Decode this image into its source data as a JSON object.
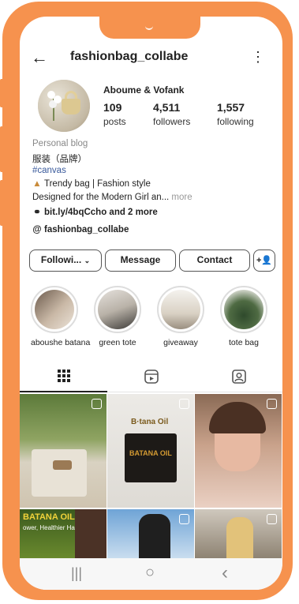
{
  "profile": {
    "handle": "fashionbag_collabe",
    "display_name": "Aboume & Vofank",
    "stats": [
      {
        "value": "109",
        "label": "posts"
      },
      {
        "value": "4,511",
        "label": "followers"
      },
      {
        "value": "1,557",
        "label": "following"
      }
    ],
    "category": "Personal blog",
    "bio_line_2": "服装（品牌）",
    "hashtag": "#canvas",
    "bio_line_4": "Trendy bag | Fashion style",
    "bio_line_5": "Designed for the Modern Girl an...",
    "more_label": " more",
    "link_text": "bit.ly/4bqCcho and 2 more",
    "threads_handle": "fashionbag_collabe"
  },
  "buttons": {
    "following": "Followi...",
    "message": "Message",
    "contact": "Contact"
  },
  "highlights": [
    {
      "label": "aboushe batana"
    },
    {
      "label": "green tote"
    },
    {
      "label": "giveaway"
    },
    {
      "label": "tote bag"
    }
  ],
  "posts": [
    {
      "caption": ""
    },
    {
      "caption": "Batana Oil"
    },
    {
      "caption": ""
    },
    {
      "caption": "BATANA OIL"
    },
    {
      "caption": ""
    },
    {
      "caption": ""
    }
  ],
  "posts_text": {
    "box_brand": "B·tana Oil",
    "box_label": "BATANA OIL",
    "banner_title": "BATANA OIL",
    "banner_sub": "ower, Healthier Hair"
  },
  "icons": [
    "back-arrow-icon",
    "kebab-menu-icon",
    "link-icon",
    "threads-icon",
    "add-person-icon",
    "grid-icon",
    "reels-icon",
    "tagged-icon",
    "reel-badge-icon"
  ],
  "system_nav": {
    "recents": "|||",
    "home": "○",
    "back": "‹"
  },
  "colors": {
    "frame": "#f6924e",
    "link": "#3a5a9b"
  }
}
